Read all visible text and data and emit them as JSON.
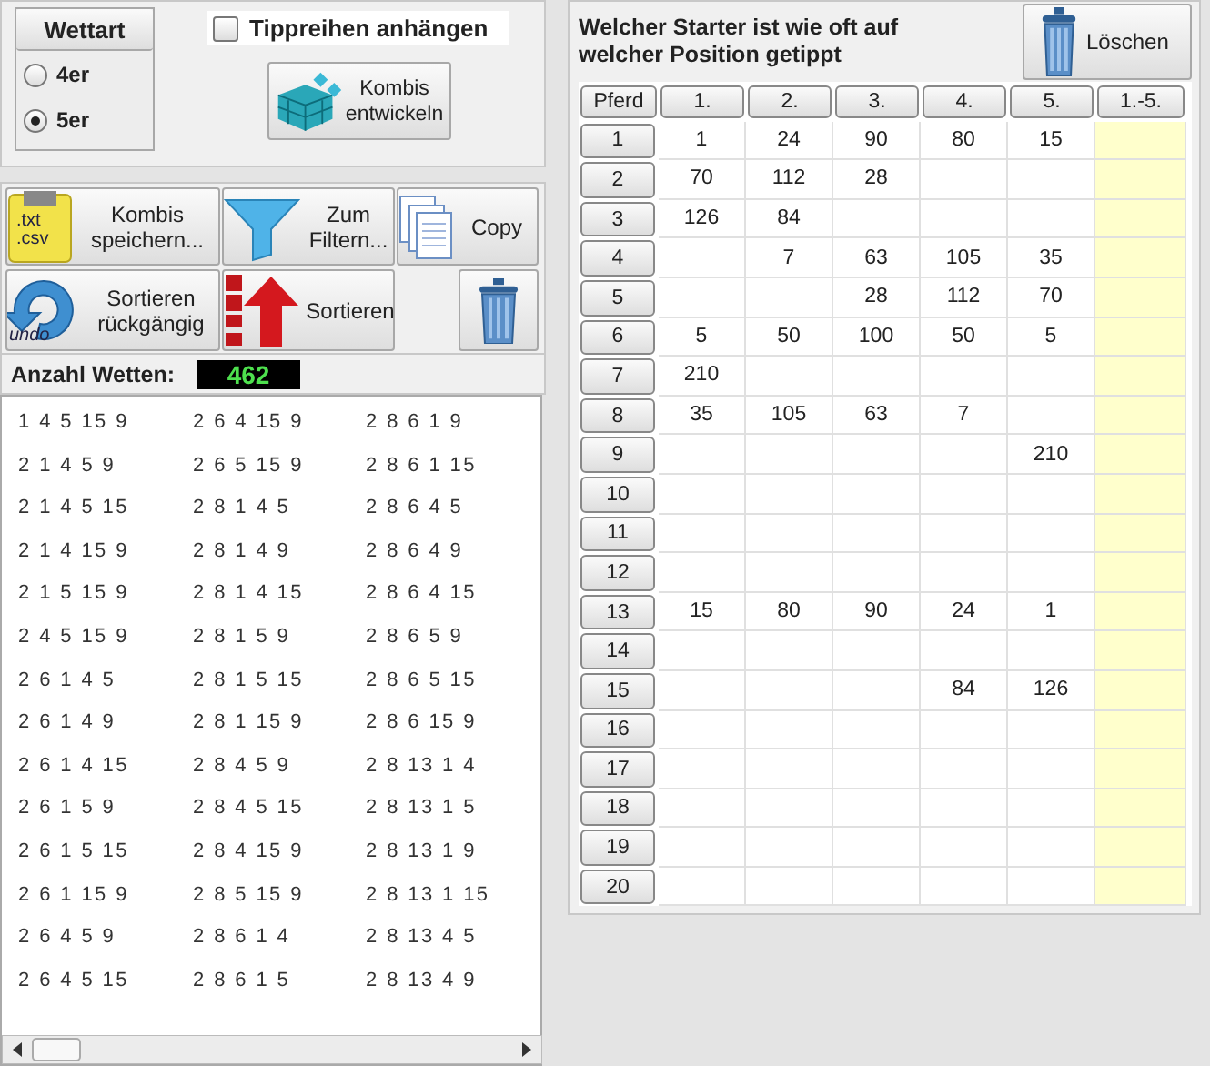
{
  "bet_type": {
    "title": "Wettart",
    "options": [
      {
        "label": "4er",
        "selected": false
      },
      {
        "label": "5er",
        "selected": true
      }
    ]
  },
  "append_checkbox": {
    "label": "Tippreihen anhängen",
    "checked": false
  },
  "develop_button": {
    "label": "Kombis entwickeln"
  },
  "tools": [
    {
      "kind": "save",
      "label": "Kombis speichern...",
      "icon_text": [
        ".txt",
        ".csv"
      ]
    },
    {
      "kind": "filter",
      "label": "Zum Filtern..."
    },
    {
      "kind": "copy",
      "label": "Copy"
    },
    {
      "kind": "undo",
      "label": "Sortieren rückgängig",
      "icon_text": [
        "undo"
      ]
    },
    {
      "kind": "sort",
      "label": "Sortieren"
    },
    {
      "kind": "trash"
    }
  ],
  "bet_count": {
    "label": "Anzahl Wetten:",
    "value": "462"
  },
  "combinations": [
    [
      "1 4 5 15 9",
      "2 1 4 5 9",
      "2 1 4 5 15",
      "2 1 4 15 9",
      "2 1 5 15 9",
      "2 4 5 15 9",
      "2 6 1 4 5",
      "2 6 1 4 9",
      "2 6 1 4 15",
      "2 6 1 5 9",
      "2 6 1 5 15",
      "2 6 1 15 9",
      "2 6 4 5 9",
      "2 6 4 5 15"
    ],
    [
      "2 6 4 15 9",
      "2 6 5 15 9",
      "2 8 1 4 5",
      "2 8 1 4 9",
      "2 8 1 4 15",
      "2 8 1 5 9",
      "2 8 1 5 15",
      "2 8 1 15 9",
      "2 8 4 5 9",
      "2 8 4 5 15",
      "2 8 4 15 9",
      "2 8 5 15 9",
      "2 8 6 1 4",
      "2 8 6 1 5"
    ],
    [
      "2 8 6 1 9",
      "2 8 6 1 15",
      "2 8 6 4 5",
      "2 8 6 4 9",
      "2 8 6 4 15",
      "2 8 6 5 9",
      "2 8 6 5 15",
      "2 8 6 15 9",
      "2 8 13 1 4",
      "2 8 13 1 5",
      "2 8 13 1 9",
      "2 8 13 1 15",
      "2 8 13 4 5",
      "2 8 13 4 9"
    ]
  ],
  "stats": {
    "title": "Welcher Starter ist wie oft auf welcher Position getippt",
    "clear_button": "Löschen",
    "columns": [
      "Pferd",
      "1.",
      "2.",
      "3.",
      "4.",
      "5.",
      "1.-5."
    ],
    "rows": [
      {
        "cells": [
          "1",
          "1",
          "24",
          "90",
          "80",
          "15",
          null
        ]
      },
      {
        "cells": [
          "2",
          "70",
          "112",
          "28",
          null,
          null,
          null
        ]
      },
      {
        "cells": [
          "3",
          "126",
          "84",
          null,
          null,
          null,
          null
        ]
      },
      {
        "cells": [
          "4",
          null,
          "7",
          "63",
          "105",
          "35",
          null
        ]
      },
      {
        "cells": [
          "5",
          null,
          null,
          "28",
          "112",
          "70",
          null
        ]
      },
      {
        "cells": [
          "6",
          "5",
          "50",
          "100",
          "50",
          "5",
          null
        ]
      },
      {
        "cells": [
          "7",
          "210",
          null,
          null,
          null,
          null,
          null
        ]
      },
      {
        "cells": [
          "8",
          "35",
          "105",
          "63",
          "7",
          null,
          null
        ]
      },
      {
        "cells": [
          "9",
          null,
          null,
          null,
          null,
          "210",
          null
        ]
      },
      {
        "cells": [
          "10",
          null,
          null,
          null,
          null,
          null,
          null
        ]
      },
      {
        "cells": [
          "11",
          null,
          null,
          null,
          null,
          null,
          null
        ]
      },
      {
        "cells": [
          "12",
          null,
          null,
          null,
          null,
          null,
          null
        ]
      },
      {
        "cells": [
          "13",
          "15",
          "80",
          "90",
          "24",
          "1",
          null
        ]
      },
      {
        "cells": [
          "14",
          null,
          null,
          null,
          null,
          null,
          null
        ]
      },
      {
        "cells": [
          "15",
          null,
          null,
          null,
          "84",
          "126",
          null
        ]
      },
      {
        "cells": [
          "16",
          null,
          null,
          null,
          null,
          null,
          null
        ]
      },
      {
        "cells": [
          "17",
          null,
          null,
          null,
          null,
          null,
          null
        ]
      },
      {
        "cells": [
          "18",
          null,
          null,
          null,
          null,
          null,
          null
        ]
      },
      {
        "cells": [
          "19",
          null,
          null,
          null,
          null,
          null,
          null
        ]
      },
      {
        "cells": [
          "20",
          null,
          null,
          null,
          null,
          null,
          null
        ]
      }
    ]
  }
}
